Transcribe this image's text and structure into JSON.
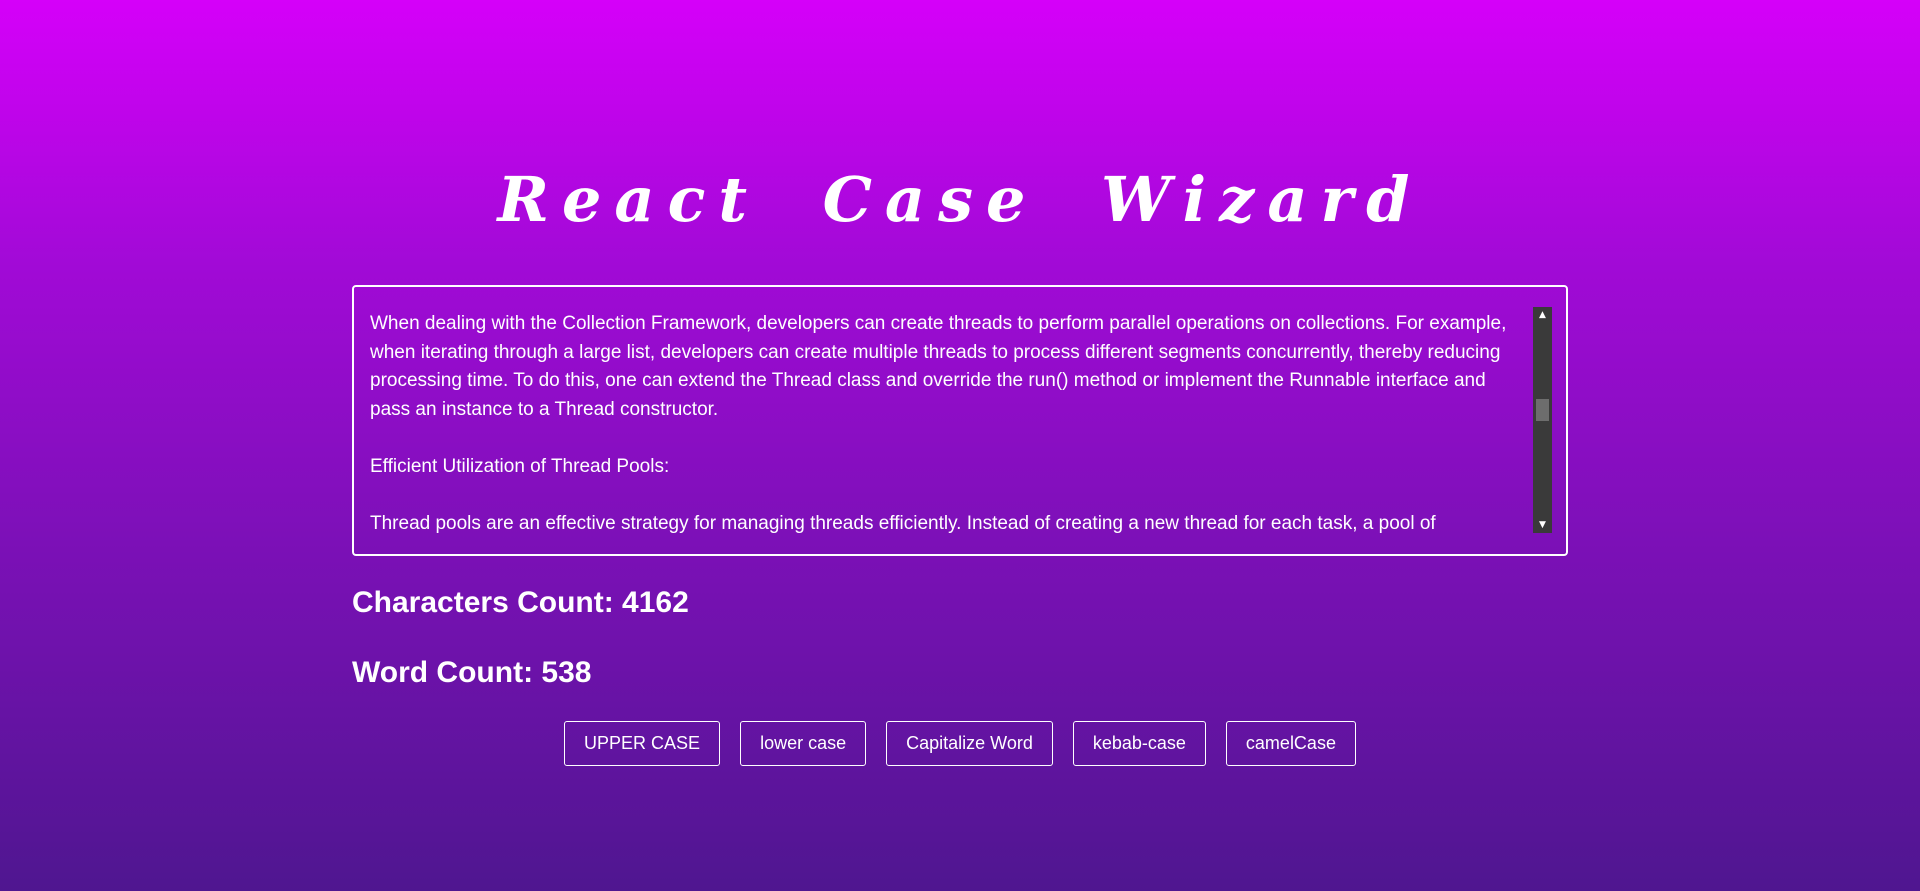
{
  "app": {
    "title": "React Case Wizard"
  },
  "editor": {
    "paragraphs": [
      "When dealing with the Collection Framework, developers can create threads to perform parallel operations on collections. For example, when iterating through a large list, developers can create multiple threads to process different segments concurrently, thereby reducing processing time. To do this, one can extend the Thread class and override the run() method or implement the Runnable interface and pass an instance to a Thread constructor.",
      "Efficient Utilization of Thread Pools:",
      "Thread pools are an effective strategy for managing threads efficiently. Instead of creating a new thread for each task, a pool of"
    ],
    "scroll_up_icon": "triangle-up-icon",
    "scroll_down_icon": "triangle-down-icon"
  },
  "stats": {
    "characters": "Characters Count: 4162",
    "words": "Word Count: 538"
  },
  "buttons": {
    "upper": "UPPER CASE",
    "lower": "lower case",
    "capitalize": "Capitalize Word",
    "kebab": "kebab-case",
    "camel": "camelCase"
  },
  "colors": {
    "background_top": "#d500f9",
    "background_bottom": "#4f1690",
    "text": "#ffffff",
    "scrollbar_track": "#3a3a3a",
    "scrollbar_thumb": "#6d6d6d"
  }
}
